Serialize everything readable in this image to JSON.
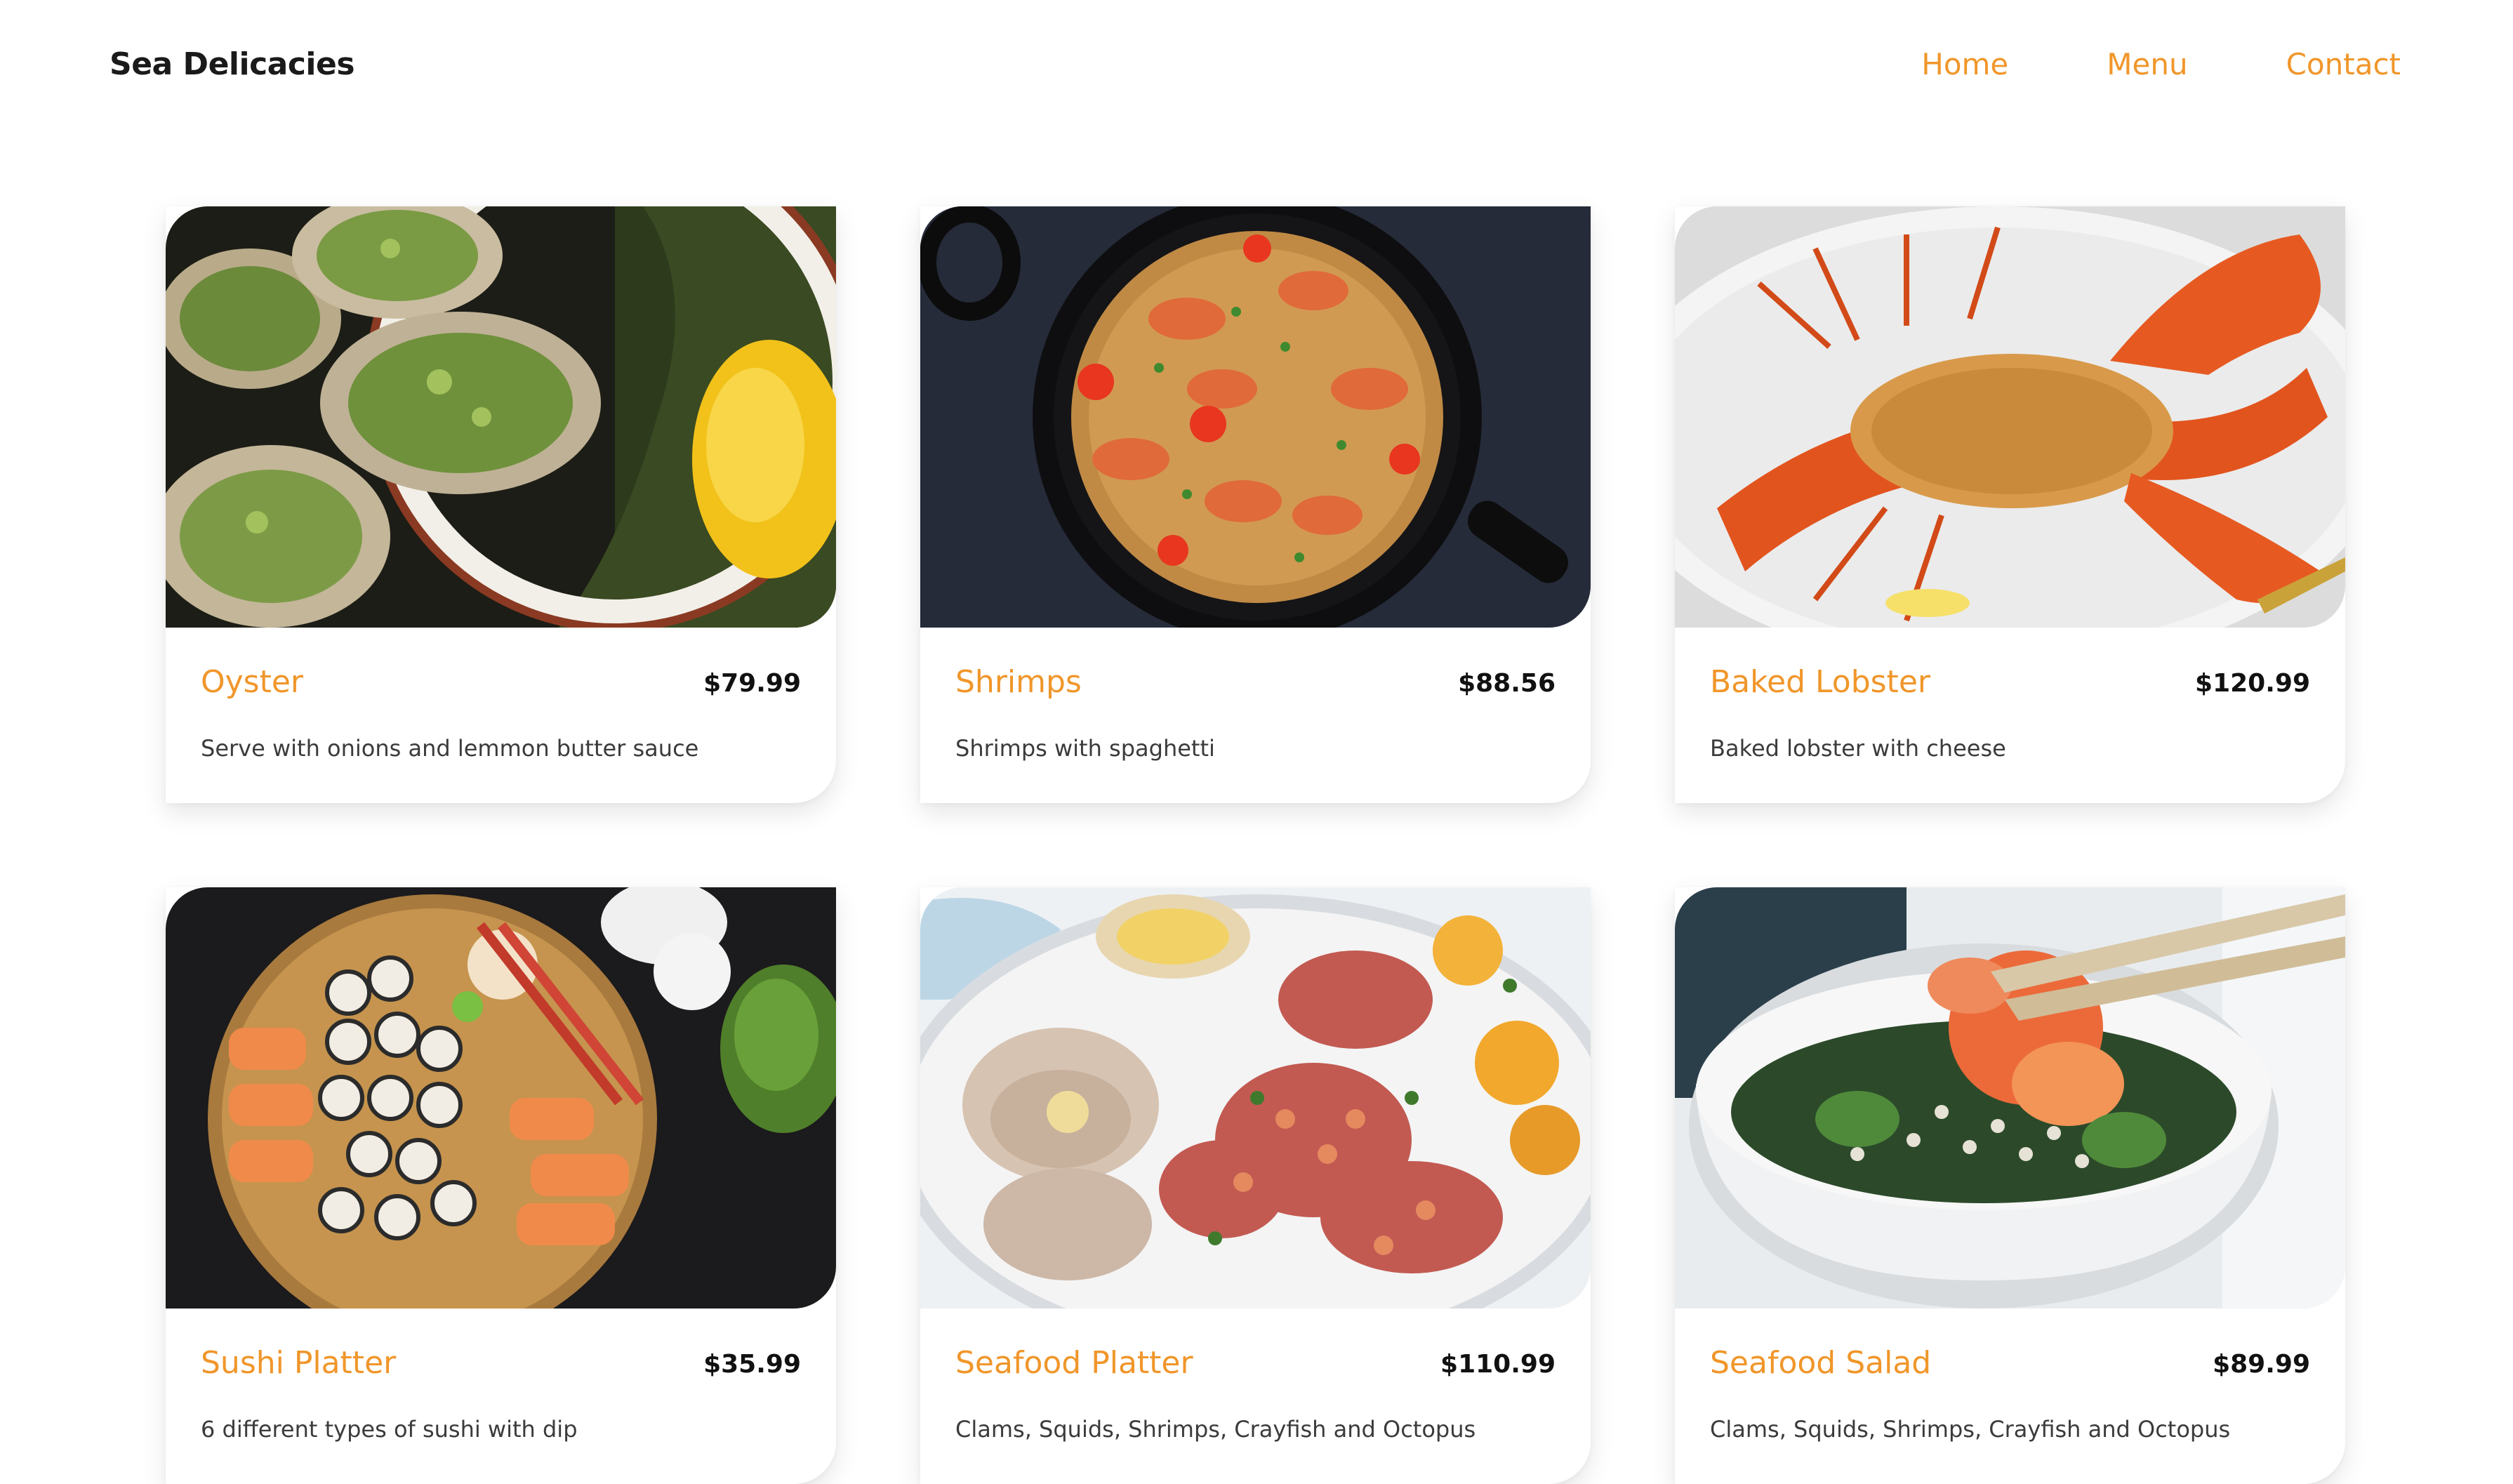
{
  "header": {
    "brand": "Sea Delicacies",
    "nav": [
      "Home",
      "Menu",
      "Contact"
    ]
  },
  "colors": {
    "accent": "#f0962a",
    "text": "#111111",
    "muted": "#3b3b3b"
  },
  "menu": [
    {
      "title": "Oyster",
      "price": "$79.99",
      "description": "Serve with onions and lemmon butter sauce",
      "image": "oysters-photo"
    },
    {
      "title": "Shrimps",
      "price": "$88.56",
      "description": "Shrimps with spaghetti",
      "image": "shrimp-pasta-photo"
    },
    {
      "title": "Baked Lobster",
      "price": "$120.99",
      "description": "Baked lobster with cheese",
      "image": "baked-lobster-photo"
    },
    {
      "title": "Sushi Platter",
      "price": "$35.99",
      "description": "6 different types of sushi with dip",
      "image": "sushi-platter-photo"
    },
    {
      "title": "Seafood Platter",
      "price": "$110.99",
      "description": "Clams, Squids, Shrimps, Crayfish and Octopus",
      "image": "seafood-platter-photo"
    },
    {
      "title": "Seafood Salad",
      "price": "$89.99",
      "description": "Clams, Squids, Shrimps, Crayfish and Octopus",
      "image": "seafood-salad-photo"
    }
  ]
}
